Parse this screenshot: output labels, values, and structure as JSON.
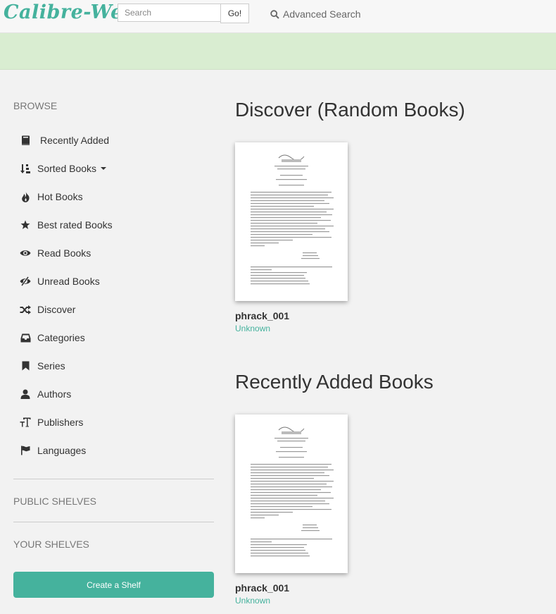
{
  "header": {
    "brand": "Calibre-Web",
    "search_placeholder": "Search",
    "go_label": "Go!",
    "advanced_search_label": "Advanced Search"
  },
  "sidebar": {
    "browse_header": "BROWSE",
    "items": [
      {
        "label": "Recently Added",
        "icon": "book-icon"
      },
      {
        "label": "Sorted Books",
        "icon": "sort-icon"
      },
      {
        "label": "Hot Books",
        "icon": "fire-icon"
      },
      {
        "label": "Best rated Books",
        "icon": "star-icon"
      },
      {
        "label": "Read Books",
        "icon": "eye-icon"
      },
      {
        "label": "Unread Books",
        "icon": "eye-slash-icon"
      },
      {
        "label": "Discover",
        "icon": "shuffle-icon"
      },
      {
        "label": "Categories",
        "icon": "inbox-icon"
      },
      {
        "label": "Series",
        "icon": "bookmark-icon"
      },
      {
        "label": "Authors",
        "icon": "user-icon"
      },
      {
        "label": "Publishers",
        "icon": "text-size-icon"
      },
      {
        "label": "Languages",
        "icon": "flag-icon"
      }
    ],
    "public_shelves_header": "PUBLIC SHELVES",
    "your_shelves_header": "YOUR SHELVES",
    "create_shelf_label": "Create a Shelf"
  },
  "main": {
    "discover_title": "Discover (Random Books)",
    "discover_books": [
      {
        "title": "phrack_001",
        "author": "Unknown"
      }
    ],
    "recent_title": "Recently Added Books",
    "recent_books": [
      {
        "title": "phrack_001",
        "author": "Unknown"
      }
    ]
  },
  "colors": {
    "accent": "#45b29d",
    "flash_background": "#d9edd1",
    "page_background": "#f2f2f2"
  }
}
